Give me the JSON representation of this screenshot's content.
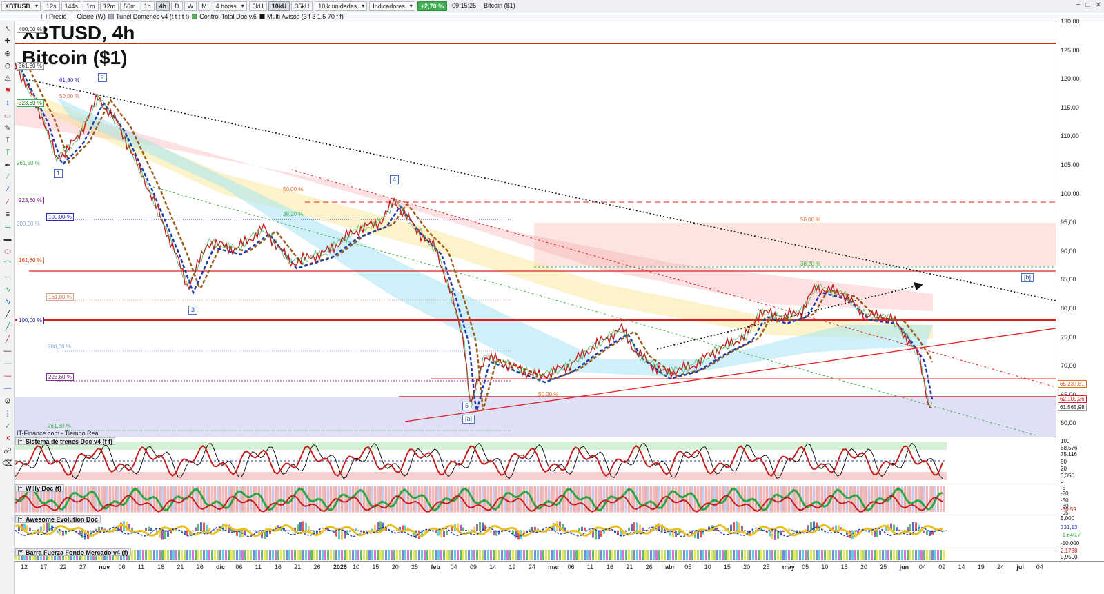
{
  "toolbar": {
    "symbol": "XBTUSD",
    "timeframes": [
      "12s",
      "144s",
      "1m",
      "12m",
      "56m",
      "1h",
      "4h",
      "D",
      "W",
      "M"
    ],
    "active_timeframe": "4h",
    "period_select": "4 horas",
    "volumes": [
      "5kU",
      "10kU",
      "35kU"
    ],
    "active_volume": "10kU",
    "units_select": "10 k unidades",
    "indicators_label": "Indicadores",
    "change": "+2,70 %",
    "time": "09:15:25",
    "instrument_name": "Bitcoin ($1)"
  },
  "legend": {
    "items": [
      {
        "label": "Precio",
        "color": "#ffffff"
      },
      {
        "label": "Cierre (W)",
        "color": "#ffffff"
      },
      {
        "label": "Tunel Domenec v4 (t t t t t)",
        "color": "#9aa5b1"
      },
      {
        "label": "Control Total Doc v.6",
        "color": "#3fb04f"
      },
      {
        "label": "Multi Avisos (3 f 3 1,5 70 f f)",
        "color": "#111111"
      }
    ]
  },
  "title": {
    "line1": "XBTUSD, 4h",
    "line2": "Bitcoin ($1)"
  },
  "source": "IT-Finance.com - Tiempo Real",
  "colors": {
    "red": "#e02020",
    "green": "#22a33a",
    "blue": "#1f3fb0",
    "brown": "#9b5a1a"
  },
  "main_axis": {
    "ticks": [
      "130,00",
      "125,00",
      "120,00",
      "115,00",
      "110,00",
      "105,00",
      "100,00",
      "95,00",
      "90,00",
      "85,00",
      "80,00",
      "75,00",
      "70,00",
      "65,00",
      "60,00"
    ],
    "price_labels": [
      "65.237,81",
      "62.109,26",
      "61.565,98"
    ]
  },
  "fib_labels": [
    {
      "text": "400,00 %"
    },
    {
      "text": "361,80 %"
    },
    {
      "text": "61,80 %"
    },
    {
      "text": "50,00 %"
    },
    {
      "text": "323,60 %"
    },
    {
      "text": "261,80 %"
    },
    {
      "text": "223,60 %"
    },
    {
      "text": "100,00 %"
    },
    {
      "text": "200,00 %"
    },
    {
      "text": "161,80 %"
    },
    {
      "text": "161,80 %"
    },
    {
      "text": "100,00 %"
    },
    {
      "text": "200,00 %"
    },
    {
      "text": "223,60 %"
    },
    {
      "text": "261,80 %"
    },
    {
      "text": "50,00 %"
    },
    {
      "text": "38,20 %"
    },
    {
      "text": "50,00 %"
    },
    {
      "text": "38,20 %"
    },
    {
      "text": "50,00 %"
    }
  ],
  "waves": [
    "1",
    "2",
    "3",
    "4",
    "5",
    "[a]",
    "[b]"
  ],
  "panels": [
    {
      "name": "Sistema de trenes Doc v4 (f f)",
      "ticks": [
        "100",
        "88,576",
        "75,116",
        "50",
        "20",
        "3,350",
        "0"
      ]
    },
    {
      "name": "Willy Doc (t)",
      "ticks": [
        "-5",
        "-20",
        "-50",
        "-80",
        "-86,59",
        "-95"
      ]
    },
    {
      "name": "Awesome Evolution Doc",
      "ticks": [
        "5.000",
        "331,13",
        "-1.640,7",
        "-10.000"
      ]
    },
    {
      "name": "Barra Fuerza Fondo Mercado v4 (f)",
      "ticks": [
        "2,1788",
        "0,9500"
      ]
    }
  ],
  "xaxis": {
    "labels": [
      "12",
      "17",
      "22",
      "27",
      "nov",
      "06",
      "11",
      "16",
      "21",
      "26",
      "dic",
      "06",
      "11",
      "16",
      "21",
      "26",
      "2026",
      "10",
      "15",
      "20",
      "25",
      "feb",
      "04",
      "09",
      "14",
      "19",
      "24",
      "mar",
      "06",
      "11",
      "16",
      "21",
      "26",
      "abr",
      "05",
      "10",
      "15",
      "20",
      "25",
      "may",
      "05",
      "10",
      "15",
      "20",
      "25",
      "jun",
      "04",
      "09",
      "14",
      "19",
      "24",
      "jul",
      "04"
    ]
  }
}
